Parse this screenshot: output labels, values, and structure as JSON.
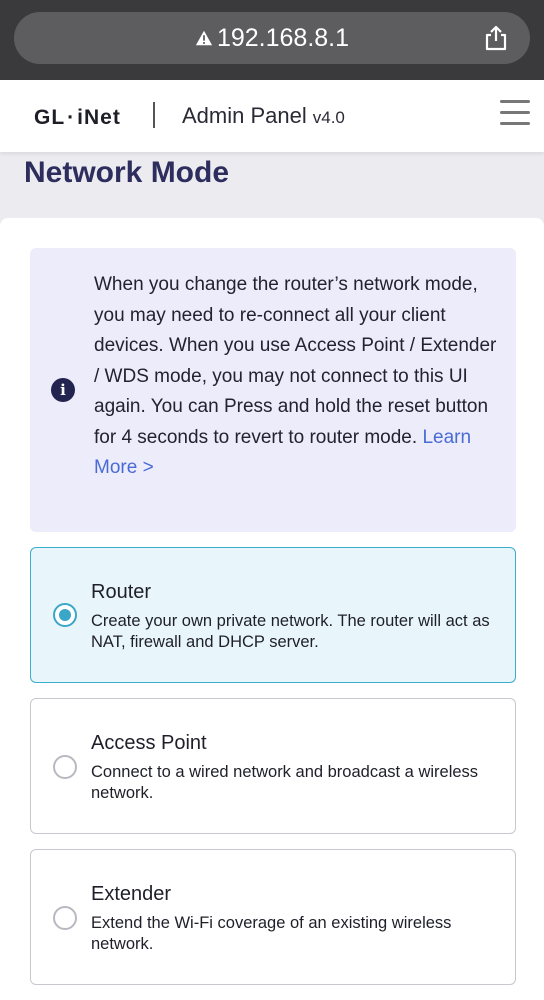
{
  "browser": {
    "url": "192.168.8.1",
    "warning_icon": "warning-triangle-icon",
    "share_icon": "share-icon"
  },
  "header": {
    "logo_left": "GL",
    "logo_dot": "·",
    "logo_right": "iNet",
    "title": "Admin Panel",
    "version": "v4.0",
    "menu_icon": "hamburger-menu-icon"
  },
  "page": {
    "title": "Network Mode"
  },
  "info": {
    "icon": "info-icon",
    "icon_glyph": "i",
    "text": "When you change the router’s network mode, you may need to re-connect all your client devices. When you use Access Point / Extender / WDS mode, you may not connect to this UI again. You can Press and hold the reset button for 4 seconds to revert to router mode.",
    "link": "Learn More >"
  },
  "options": [
    {
      "title": "Router",
      "description": "Create your own private network. The router will act as NAT, firewall and DHCP server.",
      "selected": true
    },
    {
      "title": "Access Point",
      "description": "Connect to a wired network and broadcast a wireless network.",
      "selected": false
    },
    {
      "title": "Extender",
      "description": "Extend the Wi-Fi coverage of an existing wireless network.",
      "selected": false
    }
  ],
  "colors": {
    "accent": "#3aa6c8",
    "title": "#2d2d5e",
    "link": "#4a6bd4",
    "info_bg": "#ececfa"
  }
}
